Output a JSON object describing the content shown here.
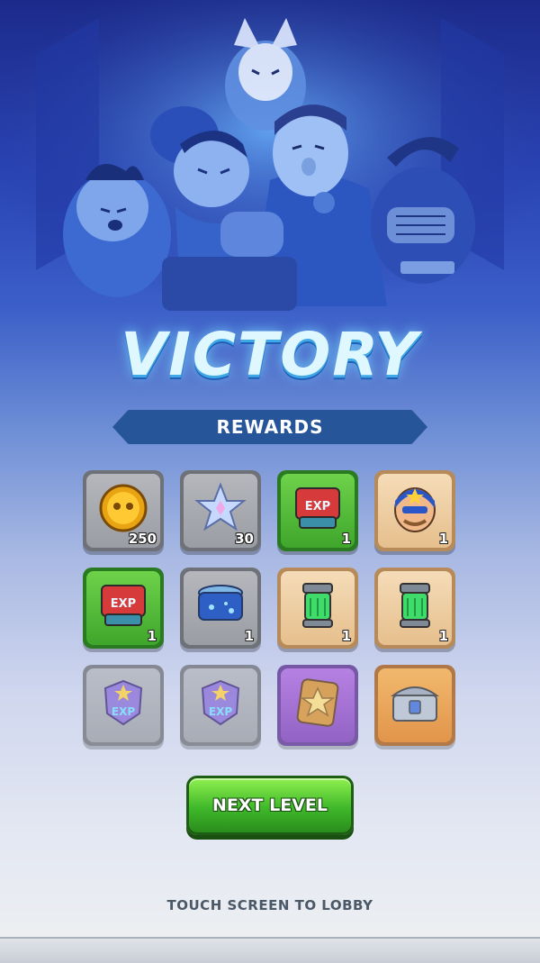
{
  "hero": {
    "icon": "hero-group-illustration"
  },
  "title": "VICTORY",
  "rewards_header": "REWARDS",
  "rewards": [
    {
      "name": "coin-icon",
      "count": "250",
      "style": "gray"
    },
    {
      "name": "star-gem-icon",
      "count": "30",
      "style": "gray"
    },
    {
      "name": "exp-card-icon",
      "count": "1",
      "style": "green"
    },
    {
      "name": "masked-hero-portrait-icon",
      "count": "1",
      "style": "tan"
    },
    {
      "name": "exp-card-icon",
      "count": "1",
      "style": "green"
    },
    {
      "name": "blue-chest-icon",
      "count": "1",
      "style": "gray"
    },
    {
      "name": "green-energy-capsule-icon",
      "count": "1",
      "style": "tan"
    },
    {
      "name": "green-energy-capsule-icon",
      "count": "1",
      "style": "tan"
    },
    {
      "name": "exp-badge-icon",
      "count": "",
      "style": "gray"
    },
    {
      "name": "exp-badge-icon",
      "count": "",
      "style": "gray"
    },
    {
      "name": "star-card-icon",
      "count": "",
      "style": "purple"
    },
    {
      "name": "metal-chest-icon",
      "count": "",
      "style": "orange"
    }
  ],
  "next_level_label": "NEXT LEVEL",
  "lobby_hint": "TOUCH SCREEN TO LOBBY",
  "colors": {
    "accent_blue": "#27559a",
    "button_green": "#3fb82a",
    "title_glow": "#3fa8e6"
  }
}
